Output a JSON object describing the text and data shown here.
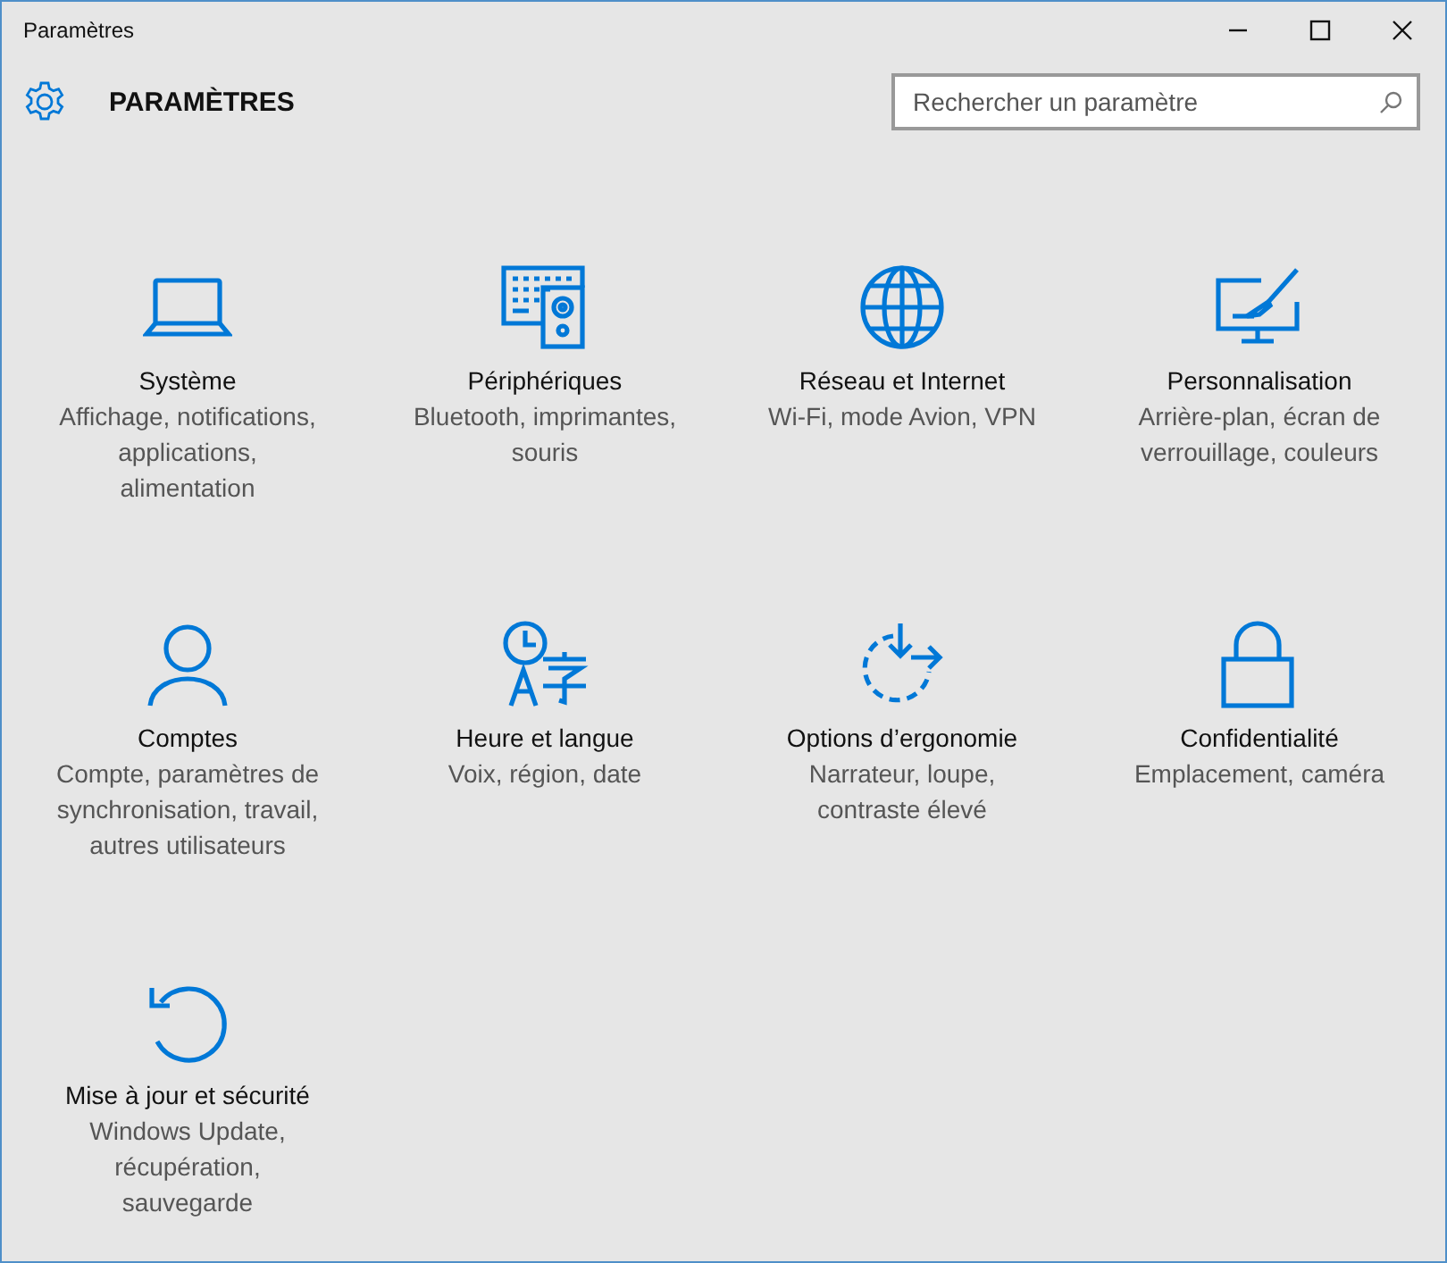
{
  "window": {
    "title": "Paramètres"
  },
  "header": {
    "title": "PARAMÈTRES",
    "search": {
      "placeholder": "Rechercher un paramètre"
    }
  },
  "categories": [
    {
      "kind": "laptop",
      "title": "Système",
      "description": "Affichage, notifications, applications, alimentation"
    },
    {
      "kind": "devices",
      "title": "Périphériques",
      "description": "Bluetooth, imprimantes, souris"
    },
    {
      "kind": "globe",
      "title": "Réseau et Internet",
      "description": "Wi-Fi, mode Avion, VPN"
    },
    {
      "kind": "paint",
      "title": "Personnalisation",
      "description": "Arrière-plan, écran de verrouillage, couleurs"
    },
    {
      "kind": "person",
      "title": "Comptes",
      "description": "Compte, paramètres de synchronisation, travail, autres utilisateurs"
    },
    {
      "kind": "time-language",
      "title": "Heure et langue",
      "description": "Voix, région, date"
    },
    {
      "kind": "ease",
      "title": "Options d’ergonomie",
      "description": "Narrateur, loupe, contraste élevé"
    },
    {
      "kind": "lock",
      "title": "Confidentialité",
      "description": "Emplacement, caméra"
    },
    {
      "kind": "update",
      "title": "Mise à jour et sécurité",
      "description": "Windows Update, récupération, sauvegarde"
    }
  ]
}
